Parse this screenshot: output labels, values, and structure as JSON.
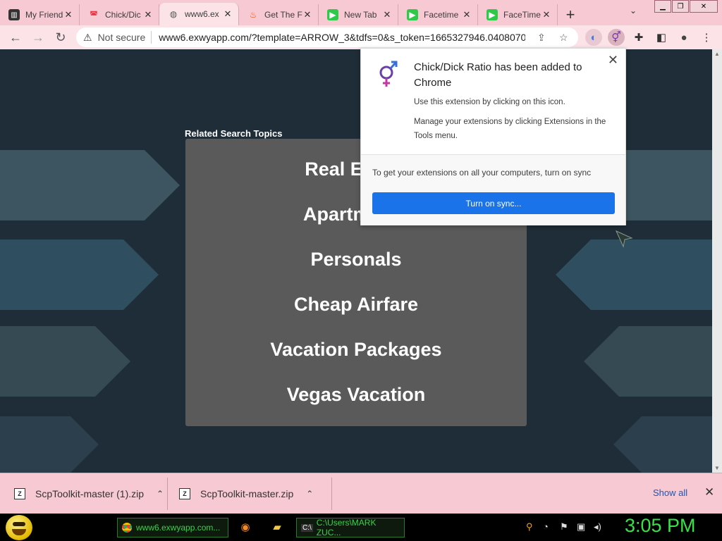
{
  "tabs": [
    {
      "label": "My Friend",
      "icon": "book-icon"
    },
    {
      "label": "Chick/Dic",
      "icon": "rainbow-icon"
    },
    {
      "label": "www6.ex",
      "icon": "globe-icon"
    },
    {
      "label": "Get The F",
      "icon": "fire-icon"
    },
    {
      "label": "New Tab",
      "icon": "facetime-icon"
    },
    {
      "label": "Facetime",
      "icon": "facetime-icon"
    },
    {
      "label": "FaceTime",
      "icon": "facetime-icon"
    }
  ],
  "toolbar": {
    "security_label": "Not secure",
    "url": "www6.exwyapp.com/?template=ARROW_3&tdfs=0&s_token=1665327946.0408070..."
  },
  "page": {
    "related_title": "Related Search Topics",
    "topics": [
      "Real Estate",
      "Apartments",
      "Personals",
      "Cheap Airfare",
      "Vacation Packages",
      "Vegas Vacation"
    ],
    "colors": {
      "background": "#1f2d38",
      "panel": "#5a5a5a"
    }
  },
  "popup": {
    "title": "Chick/Dick Ratio has been added to Chrome",
    "line1": "Use this extension by clicking on this icon.",
    "line2": "Manage your extensions by clicking Extensions in the Tools menu.",
    "sync_text": "To get your extensions on all your computers, turn on sync",
    "sync_button": "Turn on sync...",
    "accent": "#1a73e8"
  },
  "downloads": {
    "items": [
      {
        "name": "ScpToolkit-master (1).zip"
      },
      {
        "name": "ScpToolkit-master.zip"
      }
    ],
    "show_all": "Show all"
  },
  "taskbar": {
    "apps": [
      {
        "label": "www6.exwyapp.com..."
      },
      {
        "label": "C:\\Users\\MARK ZUC..."
      }
    ],
    "clock": "3:05 PM"
  }
}
